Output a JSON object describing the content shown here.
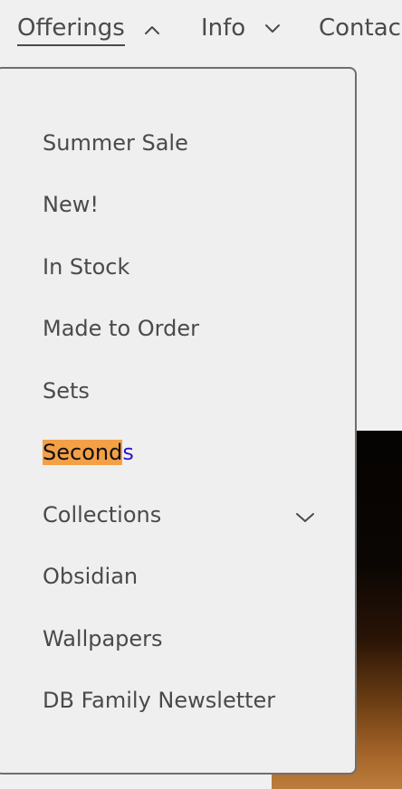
{
  "nav": {
    "offerings": "Offerings",
    "info": "Info",
    "contact": "Contac"
  },
  "menu": {
    "items": [
      {
        "label": "Summer Sale"
      },
      {
        "label": "New!"
      },
      {
        "label": "In Stock"
      },
      {
        "label": "Made to Order"
      },
      {
        "label": "Sets"
      },
      {
        "label_highlighted": "Second",
        "label_rest": "s"
      },
      {
        "label": "Collections",
        "icon": "chevron-down-icon"
      },
      {
        "label": "Obsidian"
      },
      {
        "label": "Wallpapers"
      },
      {
        "label": "DB Family Newsletter"
      }
    ]
  },
  "colors": {
    "text": "#4a4a4a",
    "highlight": "#f4a046",
    "link": "#2b17c9",
    "background": "#f0f0f0",
    "border": "#6e6e6e"
  }
}
